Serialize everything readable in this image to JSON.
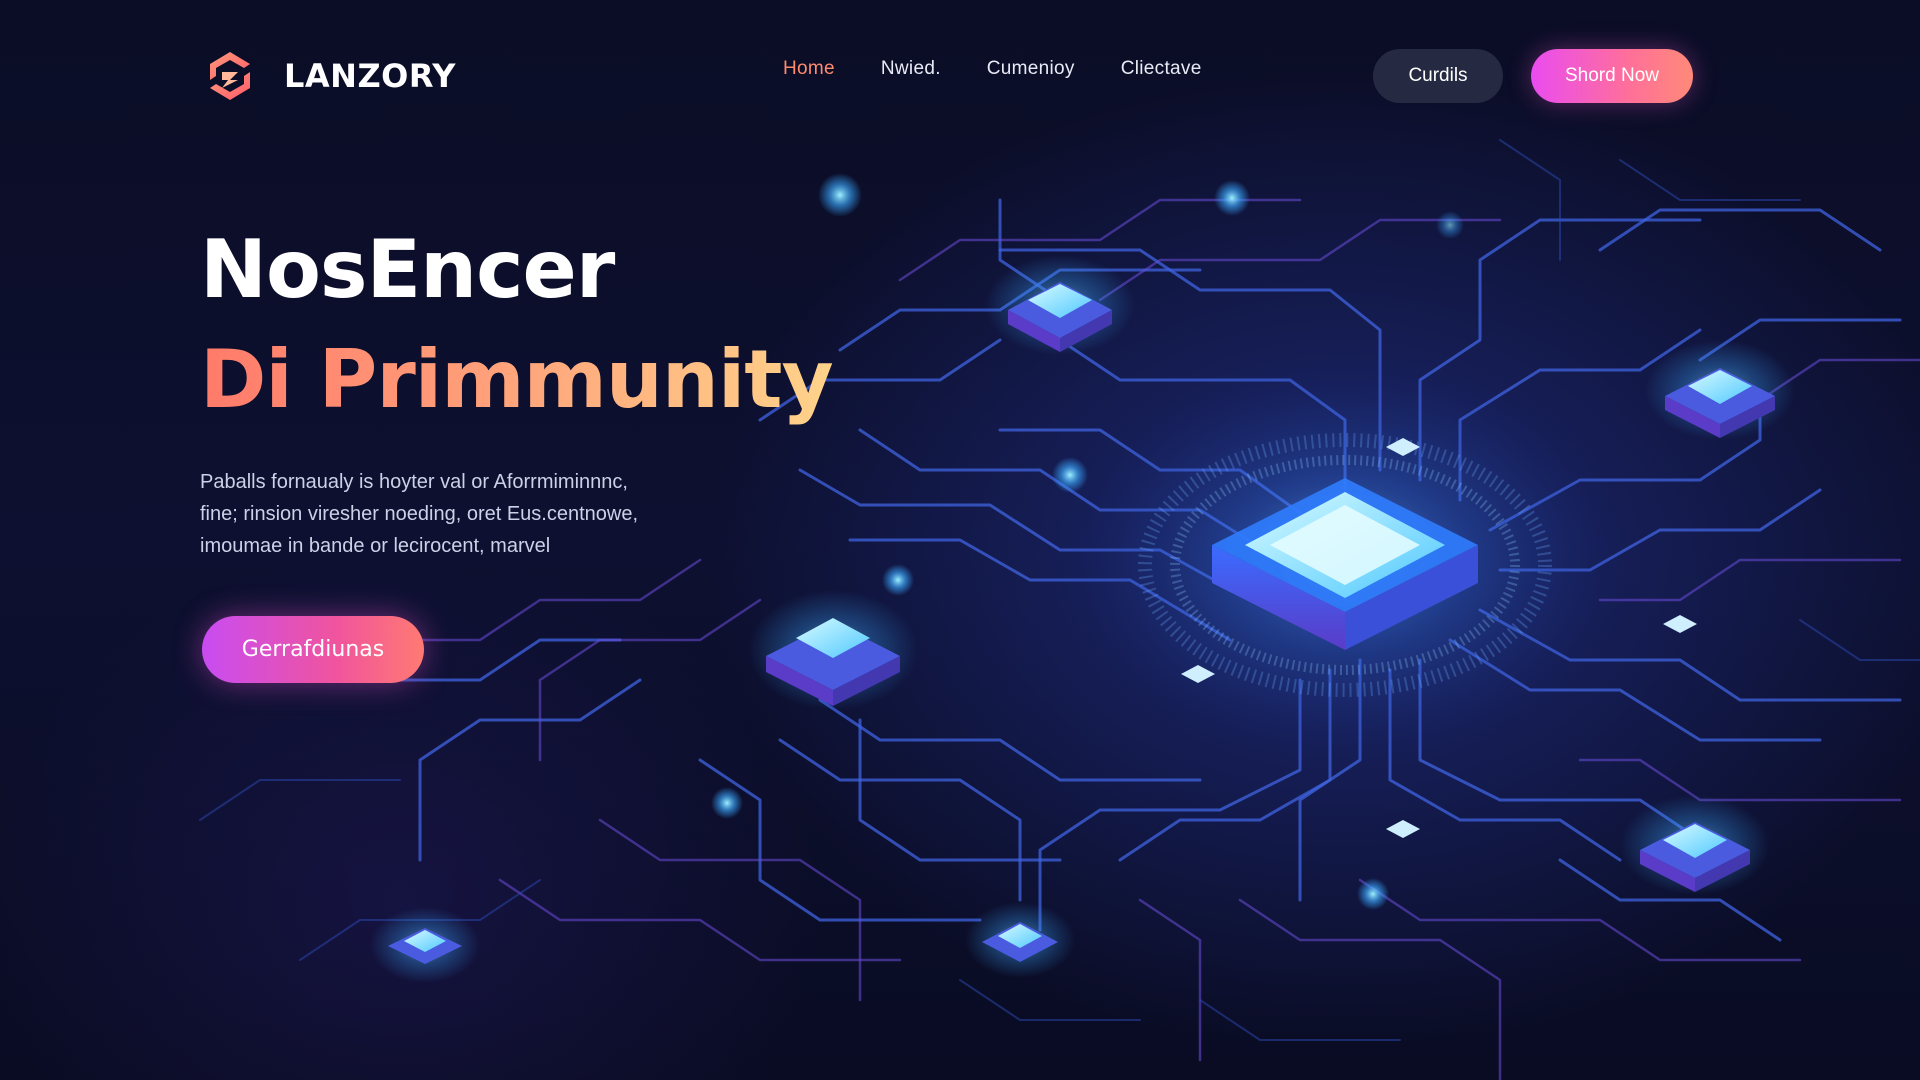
{
  "brand": {
    "name": "LANZORY",
    "logo_icon": "brand-logo-icon"
  },
  "nav": {
    "items": [
      {
        "label": "Home",
        "active": true
      },
      {
        "label": "Nwied.",
        "active": false
      },
      {
        "label": "Cumenioy",
        "active": false
      },
      {
        "label": "Cliectave",
        "active": false
      }
    ]
  },
  "header_actions": {
    "secondary_label": "Curdils",
    "primary_label": "Shord Now"
  },
  "hero": {
    "title_line1": "NosEncer",
    "title_line2": "Di Primmunity",
    "description_lines": [
      "Paballs fornaualy is hoyter val or Aforrmiminnnc,",
      "fine; rinsion viresher noeding, oret Eus.centnowe,",
      "imoumae in bande or lecirocent, marvel"
    ],
    "cta_label": "Gerrafdiunas"
  },
  "colors": {
    "background": "#0a0c24",
    "accent_orange": "#ff8a6e",
    "accent_magenta": "#e94cf0",
    "circuit_blue": "#4a7dff",
    "chip_cyan": "#7fe6ff"
  }
}
